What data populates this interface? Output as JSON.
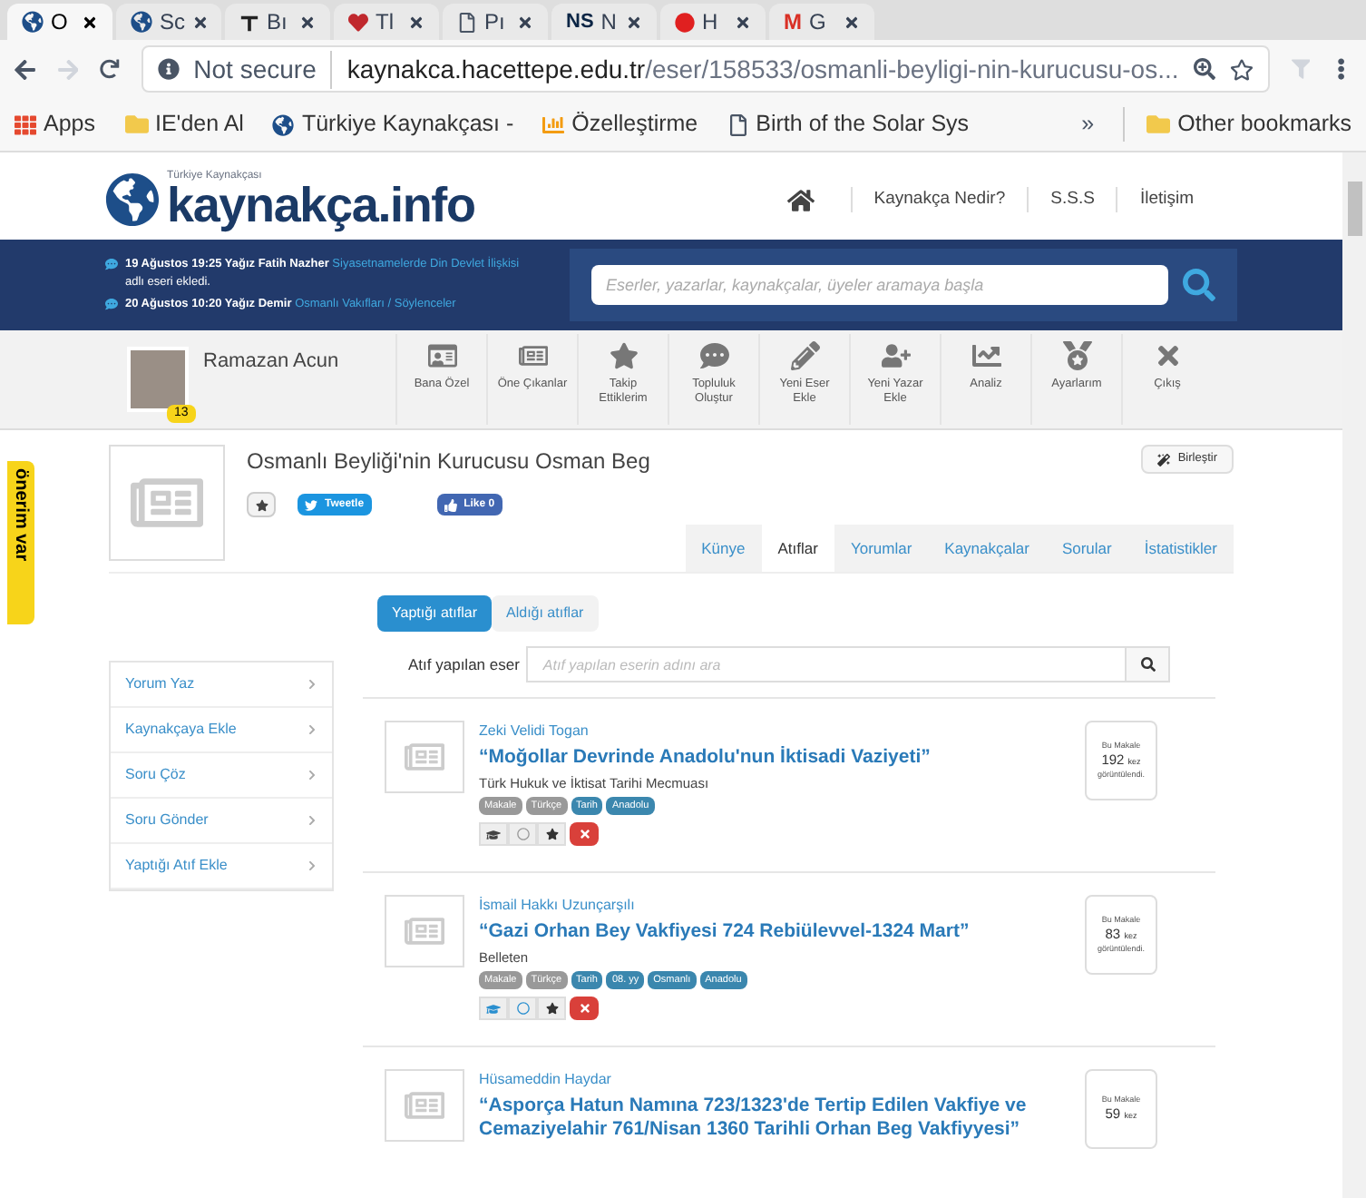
{
  "browser": {
    "tabs": [
      {
        "label": "O",
        "kind": "globe",
        "selected": true
      },
      {
        "label": "Sc",
        "kind": "globe",
        "selected": false
      },
      {
        "label": "Bı",
        "kind": "letter",
        "selected": false
      },
      {
        "label": "Tl",
        "kind": "heart",
        "selected": false
      },
      {
        "label": "Pı",
        "kind": "doc",
        "selected": false
      },
      {
        "label": "N",
        "kind": "ns",
        "badge": "NS",
        "selected": false
      },
      {
        "label": "H",
        "kind": "red",
        "selected": false
      },
      {
        "label": "G",
        "kind": "mail",
        "badge": "M",
        "selected": false
      }
    ],
    "security": "Not secure",
    "url_host": "kaynakca.hacettepe.edu.tr",
    "url_path": "/eser/158533/osmanli-beyligi-nin-kurucusu-os...",
    "bookmarks": [
      {
        "label": "Apps",
        "kind": "apps"
      },
      {
        "label": "IE'den Al",
        "kind": "folder"
      },
      {
        "label": "Türkiye Kaynakçası -",
        "kind": "globe"
      },
      {
        "label": "Özelleştirme",
        "kind": "chart"
      },
      {
        "label": "Birth of the Solar Sys",
        "kind": "doc"
      }
    ],
    "overflow": "»",
    "other_bookmarks": "Other bookmarks"
  },
  "site": {
    "logo_small": "Türkiye Kaynakçası",
    "logo": "kaynakça.info",
    "links": [
      "Kaynakça Nedir?",
      "S.S.S",
      "İletişim"
    ],
    "feed": [
      {
        "text": "19 Ağustos 19:25 Yağız Fatih Nazher",
        "link": "Siyasetnamelerde Din Devlet İlişkisi",
        "suffix": "adlı eseri ekledi."
      },
      {
        "text": "20 Ağustos 10:20 Yağız Demir",
        "link": "Osmanlı Vakıfları / Söylenceler"
      }
    ],
    "search_placeholder": "Eserler, yazarlar, kaynakçalar, üyeler aramaya başla",
    "user": {
      "name": "Ramazan Acun",
      "badge": "13"
    },
    "nav": [
      {
        "label": "Bana Özel",
        "kind": "card"
      },
      {
        "label": "Öne Çıkanlar",
        "kind": "news"
      },
      {
        "label": "Takip Ettiklerim",
        "kind": "star"
      },
      {
        "label": "Topluluk Oluştur",
        "kind": "chat"
      },
      {
        "label": "Yeni Eser Ekle",
        "kind": "pencil"
      },
      {
        "label": "Yeni Yazar Ekle",
        "kind": "user"
      },
      {
        "label": "Analiz",
        "kind": "trend"
      },
      {
        "label": "Ayarlarım",
        "kind": "medal"
      },
      {
        "label": "Çıkış",
        "kind": "x"
      }
    ],
    "side_tab": "önerim var"
  },
  "work": {
    "title": "Osmanlı Beyliği'nin Kurucusu Osman Beg",
    "tweet": "Tweetle",
    "like": "Like 0",
    "merge": "Birleştir",
    "tabs": [
      {
        "label": "Künye",
        "selected": false
      },
      {
        "label": "Atıflar",
        "selected": true
      },
      {
        "label": "Yorumlar",
        "selected": false
      },
      {
        "label": "Kaynakçalar",
        "selected": false
      },
      {
        "label": "Sorular",
        "selected": false
      },
      {
        "label": "İstatistikler",
        "selected": false
      }
    ],
    "toggle": [
      {
        "label": "Yaptığı atıflar",
        "selected": true
      },
      {
        "label": "Aldığı atıflar",
        "selected": false
      }
    ],
    "menu": [
      "Yorum Yaz",
      "Kaynakçaya Ekle",
      "Soru Çöz",
      "Soru Gönder",
      "Yaptığı Atıf Ekle"
    ],
    "search_label": "Atıf yapılan eser",
    "search_placeholder": "Atıf yapılan eserin adını ara",
    "results": [
      {
        "author": "Zeki Velidi Togan",
        "title": "“Moğollar Devrinde Anadolu'nun İktisadi Vaziyeti”",
        "source": "Türk Hukuk ve İktisat Tarihi Mecmuası",
        "tags": [
          {
            "label": "Makale",
            "kind": "type"
          },
          {
            "label": "Türkçe",
            "kind": "type"
          },
          {
            "label": "Tarih",
            "kind": "topic"
          },
          {
            "label": "Anadolu",
            "kind": "topic"
          }
        ],
        "library": false,
        "read": false,
        "views_top": "Bu Makale",
        "views": "192",
        "views_unit": "kez",
        "views_bottom": "görüntülendi."
      },
      {
        "author": "İsmail Hakkı Uzunçarşılı",
        "title": "“Gazi Orhan Bey Vakfiyesi 724 Rebiülevvel-1324 Mart”",
        "source": "Belleten",
        "tags": [
          {
            "label": "Makale",
            "kind": "type"
          },
          {
            "label": "Türkçe",
            "kind": "type"
          },
          {
            "label": "Tarih",
            "kind": "topic"
          },
          {
            "label": "08. yy",
            "kind": "topic"
          },
          {
            "label": "Osmanlı",
            "kind": "topic"
          },
          {
            "label": "Anadolu",
            "kind": "topic"
          }
        ],
        "library": true,
        "read": true,
        "views_top": "Bu Makale",
        "views": "83",
        "views_unit": "kez",
        "views_bottom": "görüntülendi."
      },
      {
        "author": "Hüsameddin Haydar",
        "title": "“Asporça Hatun Namına 723/1323'de Tertip Edilen Vakfiye ve Cemaziyelahir 761/Nisan 1360 Tarihli Orhan Beg Vakfiyyesi”",
        "views_top": "Bu Makale",
        "views": "59",
        "views_unit": "kez"
      }
    ]
  }
}
